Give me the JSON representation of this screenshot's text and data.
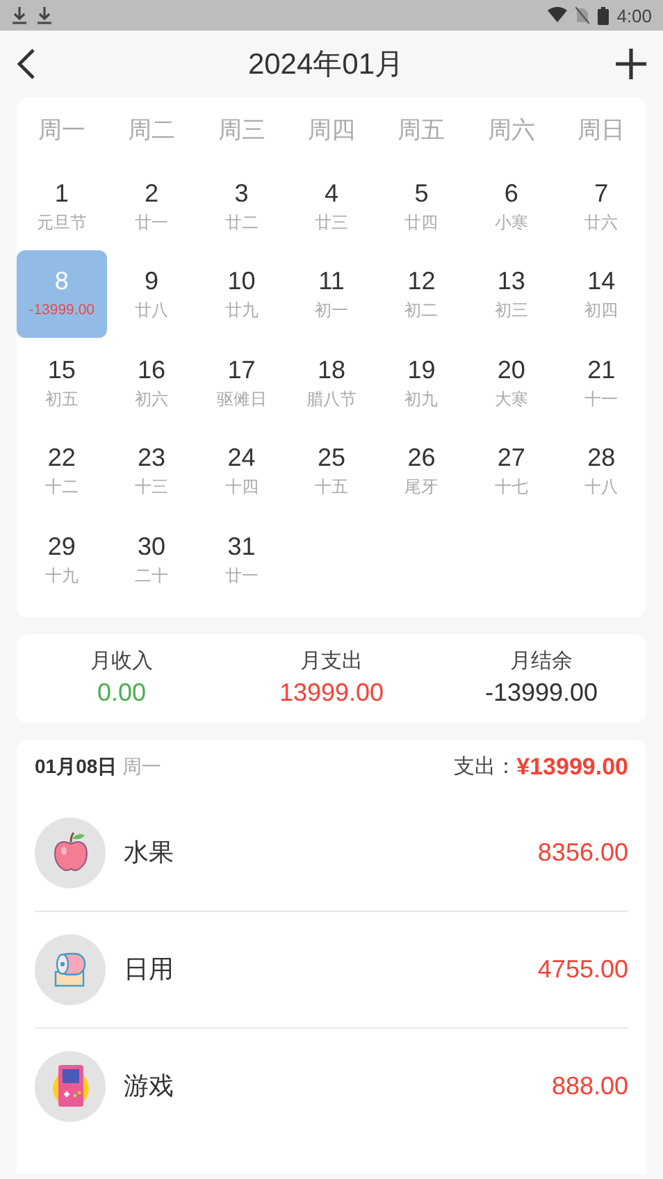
{
  "status_bar": {
    "time": "4:00"
  },
  "header": {
    "title": "2024年01月"
  },
  "calendar": {
    "weekdays": [
      "周一",
      "周二",
      "周三",
      "周四",
      "周五",
      "周六",
      "周日"
    ],
    "days": [
      {
        "day": "1",
        "lunar": "元旦节",
        "selected": false
      },
      {
        "day": "2",
        "lunar": "廿一",
        "selected": false
      },
      {
        "day": "3",
        "lunar": "廿二",
        "selected": false
      },
      {
        "day": "4",
        "lunar": "廿三",
        "selected": false
      },
      {
        "day": "5",
        "lunar": "廿四",
        "selected": false
      },
      {
        "day": "6",
        "lunar": "小寒",
        "selected": false
      },
      {
        "day": "7",
        "lunar": "廿六",
        "selected": false
      },
      {
        "day": "8",
        "amount": "-13999.00",
        "selected": true
      },
      {
        "day": "9",
        "lunar": "廿八",
        "selected": false
      },
      {
        "day": "10",
        "lunar": "廿九",
        "selected": false
      },
      {
        "day": "11",
        "lunar": "初一",
        "selected": false
      },
      {
        "day": "12",
        "lunar": "初二",
        "selected": false
      },
      {
        "day": "13",
        "lunar": "初三",
        "selected": false
      },
      {
        "day": "14",
        "lunar": "初四",
        "selected": false
      },
      {
        "day": "15",
        "lunar": "初五",
        "selected": false
      },
      {
        "day": "16",
        "lunar": "初六",
        "selected": false
      },
      {
        "day": "17",
        "lunar": "驱傩日",
        "selected": false
      },
      {
        "day": "18",
        "lunar": "腊八节",
        "selected": false
      },
      {
        "day": "19",
        "lunar": "初九",
        "selected": false
      },
      {
        "day": "20",
        "lunar": "大寒",
        "selected": false
      },
      {
        "day": "21",
        "lunar": "十一",
        "selected": false
      },
      {
        "day": "22",
        "lunar": "十二",
        "selected": false
      },
      {
        "day": "23",
        "lunar": "十三",
        "selected": false
      },
      {
        "day": "24",
        "lunar": "十四",
        "selected": false
      },
      {
        "day": "25",
        "lunar": "十五",
        "selected": false
      },
      {
        "day": "26",
        "lunar": "尾牙",
        "selected": false
      },
      {
        "day": "27",
        "lunar": "十七",
        "selected": false
      },
      {
        "day": "28",
        "lunar": "十八",
        "selected": false
      },
      {
        "day": "29",
        "lunar": "十九",
        "selected": false
      },
      {
        "day": "30",
        "lunar": "二十",
        "selected": false
      },
      {
        "day": "31",
        "lunar": "廿一",
        "selected": false
      }
    ]
  },
  "summary": [
    {
      "label": "月收入",
      "value": "0.00",
      "kind": "income"
    },
    {
      "label": "月支出",
      "value": "13999.00",
      "kind": "expense"
    },
    {
      "label": "月结余",
      "value": "-13999.00",
      "kind": "balance"
    }
  ],
  "detail": {
    "date": "01月08日",
    "weekday": "周一",
    "total_label": "支出：",
    "total": "¥13999.00",
    "items": [
      {
        "kind": "fruit",
        "name": "水果",
        "amount": "8356.00"
      },
      {
        "kind": "toilet-paper",
        "name": "日用",
        "amount": "4755.00"
      },
      {
        "kind": "game",
        "name": "游戏",
        "amount": "888.00"
      }
    ]
  }
}
